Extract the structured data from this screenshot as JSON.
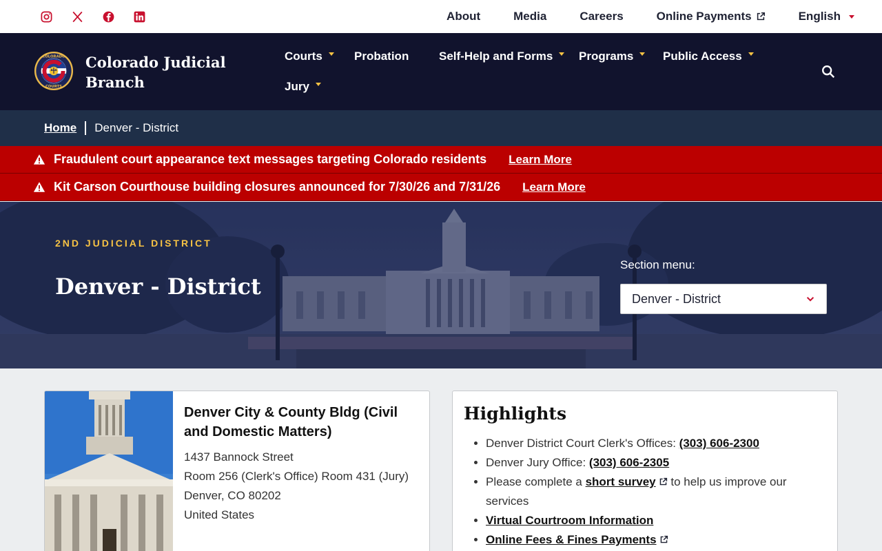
{
  "utility": {
    "social": [
      "instagram-icon",
      "x-icon",
      "facebook-icon",
      "linkedin-icon"
    ],
    "links": [
      {
        "label": "About"
      },
      {
        "label": "Media"
      },
      {
        "label": "Careers"
      },
      {
        "label": "Online Payments",
        "external": true
      },
      {
        "label": "English",
        "dropdown": true
      }
    ]
  },
  "header": {
    "site_name": "Colorado Judicial Branch",
    "logo_text_top": "COLORADO",
    "logo_text_bottom": "COURTS",
    "nav": [
      {
        "label": "Courts",
        "dropdown": true
      },
      {
        "label": "Probation",
        "dropdown": false
      },
      {
        "label": "Self-Help and Forms",
        "dropdown": true
      },
      {
        "label": "Programs",
        "dropdown": true
      },
      {
        "label": "Public Access",
        "dropdown": true
      },
      {
        "label": "Jury",
        "dropdown": true
      }
    ]
  },
  "breadcrumb": {
    "home": "Home",
    "current": "Denver - District"
  },
  "alerts": [
    {
      "message": "Fraudulent court appearance text messages targeting Colorado residents",
      "link": "Learn More"
    },
    {
      "message": "Kit Carson Courthouse building closures announced for 7/30/26 and 7/31/26",
      "link": "Learn More"
    }
  ],
  "hero": {
    "kicker": "2ND JUDICIAL DISTRICT",
    "title": "Denver - District",
    "section_menu_label": "Section menu:",
    "section_menu_value": "Denver - District"
  },
  "location": {
    "title": "Denver City & County Bldg (Civil and Domestic Matters)",
    "address": [
      "1437 Bannock Street",
      "Room 256 (Clerk's Office) Room 431 (Jury)",
      "Denver, CO 80202",
      "United States"
    ]
  },
  "highlights": {
    "title": "Highlights",
    "clerk_text": "Denver District Court Clerk's Offices: ",
    "clerk_phone": "(303) 606-2300",
    "jury_text": "Denver Jury Office: ",
    "jury_phone": "(303) 606-2305",
    "survey_before": "Please complete a ",
    "survey_link": "short survey",
    "survey_after": " to help us improve our services",
    "virtual": "Virtual Courtroom Information",
    "fees": "Online Fees & Fines Payments"
  },
  "colors": {
    "navy": "#11132d",
    "crumb": "#1f2f48",
    "alert": "#bb0000",
    "accent_red": "#c8102e",
    "gold": "#f6c244"
  }
}
